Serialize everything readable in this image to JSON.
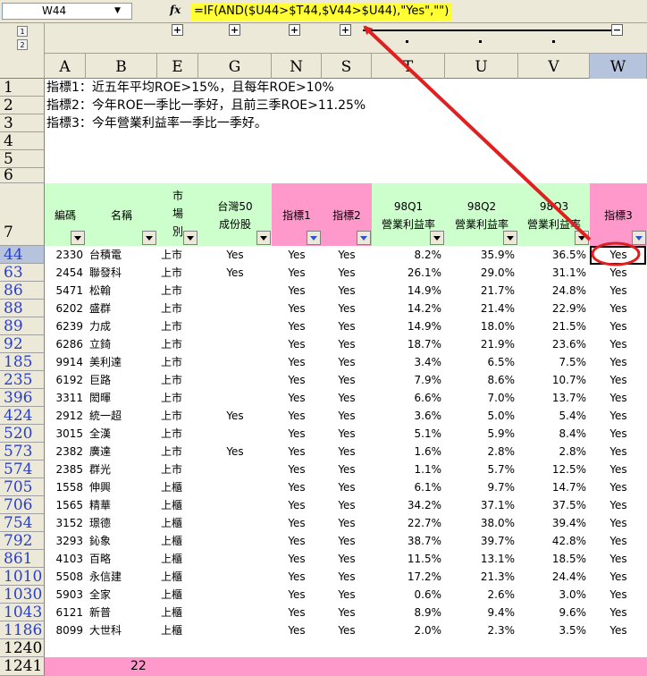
{
  "formula_bar": {
    "name_box": "W44",
    "fx_label": "fx",
    "formula": "=IF(AND($U44>$T44,$V44>$U44),\"Yes\",\"\")"
  },
  "outline": {
    "level1": "1",
    "level2": "2",
    "plus": "+",
    "minus": "−"
  },
  "columns": [
    "A",
    "B",
    "E",
    "G",
    "N",
    "S",
    "T",
    "U",
    "V",
    "W"
  ],
  "notes": [
    {
      "row": "1",
      "text": "指標1：近五年平均ROE>15%，且每年ROE>10%"
    },
    {
      "row": "2",
      "text": "指標2：今年ROE一季比一季好，且前三季ROE>11.25%"
    },
    {
      "row": "3",
      "text": "指標3：今年營業利益率一季比一季好。"
    },
    {
      "row": "4",
      "text": ""
    },
    {
      "row": "5",
      "text": ""
    },
    {
      "row": "6",
      "text": ""
    }
  ],
  "header_row_num": "7",
  "headers": {
    "code": "編碼",
    "name": "名稱",
    "market": [
      "市",
      "場",
      "別"
    ],
    "tw50": [
      "台灣50",
      "成份股"
    ],
    "ind1": "指標1",
    "ind2": "指標2",
    "q1": [
      "98Q1",
      "營業利益率"
    ],
    "q2": [
      "98Q2",
      "營業利益率"
    ],
    "q3": [
      "98Q3",
      "營業利益率"
    ],
    "ind3": "指標3"
  },
  "rows": [
    {
      "rn": "44",
      "code": "2330",
      "name": "台積電",
      "market": "上市",
      "tw50": "Yes",
      "i1": "Yes",
      "i2": "Yes",
      "q1": "8.2%",
      "q2": "35.9%",
      "q3": "36.5%",
      "i3": "Yes"
    },
    {
      "rn": "63",
      "code": "2454",
      "name": "聯發科",
      "market": "上市",
      "tw50": "Yes",
      "i1": "Yes",
      "i2": "Yes",
      "q1": "26.1%",
      "q2": "29.0%",
      "q3": "31.1%",
      "i3": "Yes"
    },
    {
      "rn": "86",
      "code": "5471",
      "name": "松翰",
      "market": "上市",
      "tw50": "",
      "i1": "Yes",
      "i2": "Yes",
      "q1": "14.9%",
      "q2": "21.7%",
      "q3": "24.8%",
      "i3": "Yes"
    },
    {
      "rn": "88",
      "code": "6202",
      "name": "盛群",
      "market": "上市",
      "tw50": "",
      "i1": "Yes",
      "i2": "Yes",
      "q1": "14.2%",
      "q2": "21.4%",
      "q3": "22.9%",
      "i3": "Yes"
    },
    {
      "rn": "89",
      "code": "6239",
      "name": "力成",
      "market": "上市",
      "tw50": "",
      "i1": "Yes",
      "i2": "Yes",
      "q1": "14.9%",
      "q2": "18.0%",
      "q3": "21.5%",
      "i3": "Yes"
    },
    {
      "rn": "92",
      "code": "6286",
      "name": "立錡",
      "market": "上市",
      "tw50": "",
      "i1": "Yes",
      "i2": "Yes",
      "q1": "18.7%",
      "q2": "21.9%",
      "q3": "23.6%",
      "i3": "Yes"
    },
    {
      "rn": "185",
      "code": "9914",
      "name": "美利達",
      "market": "上市",
      "tw50": "",
      "i1": "Yes",
      "i2": "Yes",
      "q1": "3.4%",
      "q2": "6.5%",
      "q3": "7.5%",
      "i3": "Yes"
    },
    {
      "rn": "235",
      "code": "6192",
      "name": "巨路",
      "market": "上市",
      "tw50": "",
      "i1": "Yes",
      "i2": "Yes",
      "q1": "7.9%",
      "q2": "8.6%",
      "q3": "10.7%",
      "i3": "Yes"
    },
    {
      "rn": "396",
      "code": "3311",
      "name": "閎暉",
      "market": "上市",
      "tw50": "",
      "i1": "Yes",
      "i2": "Yes",
      "q1": "6.6%",
      "q2": "7.0%",
      "q3": "13.7%",
      "i3": "Yes"
    },
    {
      "rn": "424",
      "code": "2912",
      "name": "統一超",
      "market": "上市",
      "tw50": "Yes",
      "i1": "Yes",
      "i2": "Yes",
      "q1": "3.6%",
      "q2": "5.0%",
      "q3": "5.4%",
      "i3": "Yes"
    },
    {
      "rn": "520",
      "code": "3015",
      "name": "全漢",
      "market": "上市",
      "tw50": "",
      "i1": "Yes",
      "i2": "Yes",
      "q1": "5.1%",
      "q2": "5.9%",
      "q3": "8.4%",
      "i3": "Yes"
    },
    {
      "rn": "573",
      "code": "2382",
      "name": "廣達",
      "market": "上市",
      "tw50": "Yes",
      "i1": "Yes",
      "i2": "Yes",
      "q1": "1.6%",
      "q2": "2.8%",
      "q3": "2.8%",
      "i3": "Yes"
    },
    {
      "rn": "574",
      "code": "2385",
      "name": "群光",
      "market": "上市",
      "tw50": "",
      "i1": "Yes",
      "i2": "Yes",
      "q1": "1.1%",
      "q2": "5.7%",
      "q3": "12.5%",
      "i3": "Yes"
    },
    {
      "rn": "705",
      "code": "1558",
      "name": "伸興",
      "market": "上櫃",
      "tw50": "",
      "i1": "Yes",
      "i2": "Yes",
      "q1": "6.1%",
      "q2": "9.7%",
      "q3": "14.7%",
      "i3": "Yes"
    },
    {
      "rn": "706",
      "code": "1565",
      "name": "精華",
      "market": "上櫃",
      "tw50": "",
      "i1": "Yes",
      "i2": "Yes",
      "q1": "34.2%",
      "q2": "37.1%",
      "q3": "37.5%",
      "i3": "Yes"
    },
    {
      "rn": "754",
      "code": "3152",
      "name": "璟德",
      "market": "上櫃",
      "tw50": "",
      "i1": "Yes",
      "i2": "Yes",
      "q1": "22.7%",
      "q2": "38.0%",
      "q3": "39.4%",
      "i3": "Yes"
    },
    {
      "rn": "792",
      "code": "3293",
      "name": "鈊象",
      "market": "上櫃",
      "tw50": "",
      "i1": "Yes",
      "i2": "Yes",
      "q1": "38.7%",
      "q2": "39.7%",
      "q3": "42.8%",
      "i3": "Yes"
    },
    {
      "rn": "861",
      "code": "4103",
      "name": "百略",
      "market": "上櫃",
      "tw50": "",
      "i1": "Yes",
      "i2": "Yes",
      "q1": "11.5%",
      "q2": "13.1%",
      "q3": "18.5%",
      "i3": "Yes"
    },
    {
      "rn": "1010",
      "code": "5508",
      "name": "永信建",
      "market": "上櫃",
      "tw50": "",
      "i1": "Yes",
      "i2": "Yes",
      "q1": "17.2%",
      "q2": "21.3%",
      "q3": "24.4%",
      "i3": "Yes"
    },
    {
      "rn": "1030",
      "code": "5903",
      "name": "全家",
      "market": "上櫃",
      "tw50": "",
      "i1": "Yes",
      "i2": "Yes",
      "q1": "0.6%",
      "q2": "2.6%",
      "q3": "3.0%",
      "i3": "Yes"
    },
    {
      "rn": "1043",
      "code": "6121",
      "name": "新普",
      "market": "上櫃",
      "tw50": "",
      "i1": "Yes",
      "i2": "Yes",
      "q1": "8.9%",
      "q2": "9.4%",
      "q3": "9.6%",
      "i3": "Yes"
    },
    {
      "rn": "1186",
      "code": "8099",
      "name": "大世科",
      "market": "上櫃",
      "tw50": "",
      "i1": "Yes",
      "i2": "Yes",
      "q1": "2.0%",
      "q2": "2.3%",
      "q3": "3.5%",
      "i3": "Yes"
    }
  ],
  "extra_rows": [
    "1240",
    "1241"
  ],
  "total_count": "22",
  "colors": {
    "green": "#ccffcc",
    "pink": "#ff99cc",
    "highlight": "#ffff33",
    "annotation": "#e02020"
  }
}
